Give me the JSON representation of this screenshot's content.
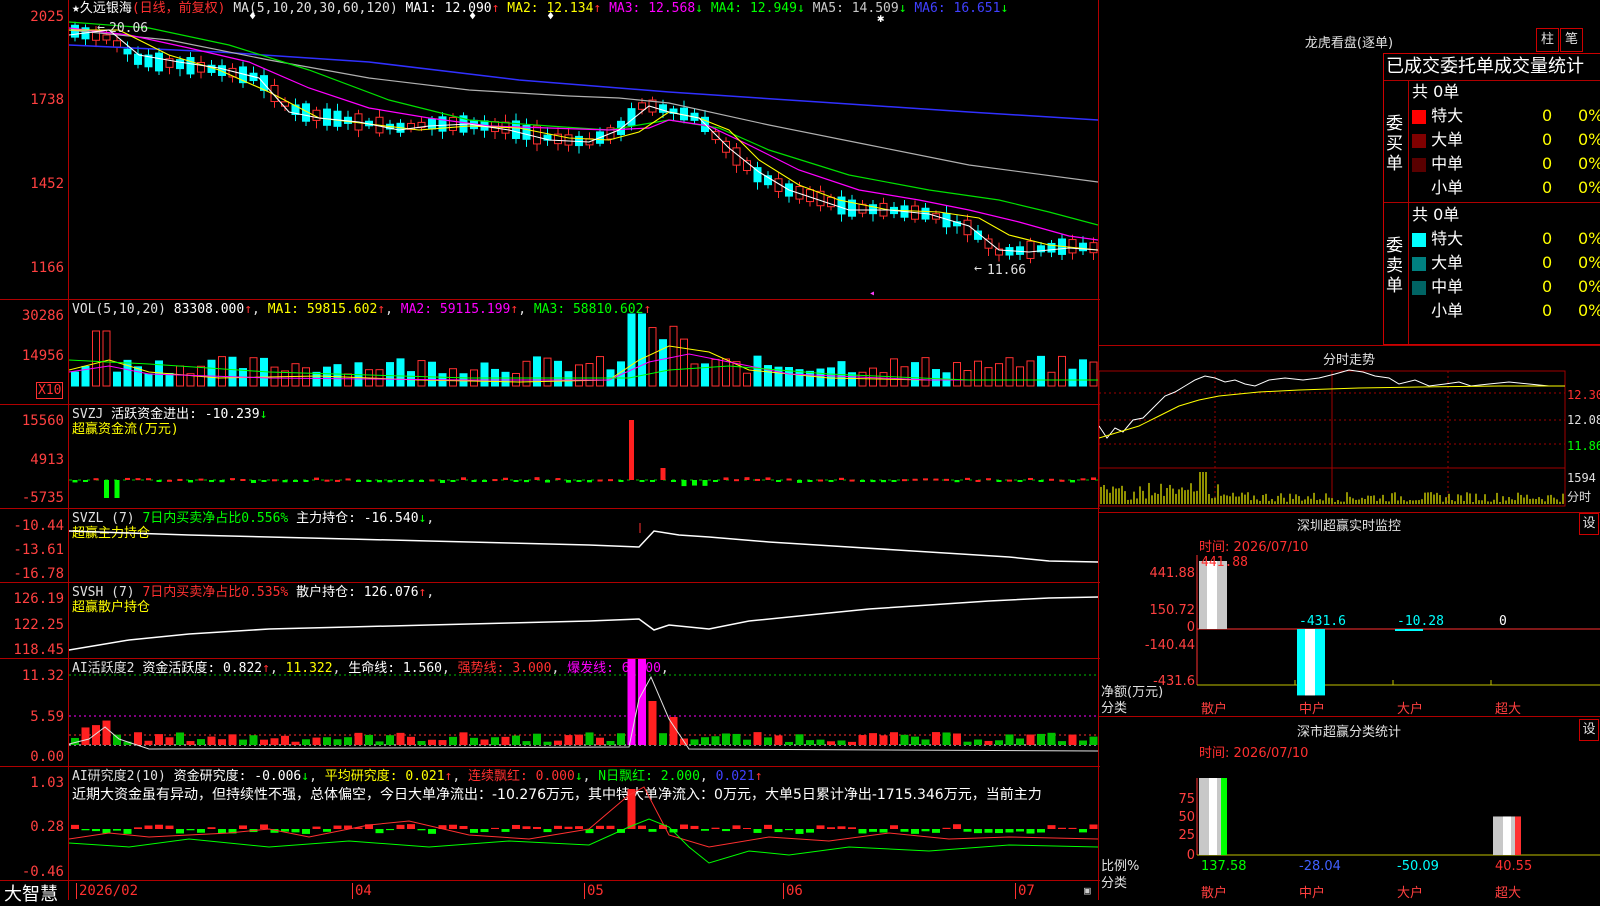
{
  "stock": {
    "star": "★",
    "name": "久远银海",
    "period": "(日线，前复权)",
    "ma_label": "MA(5,10,20,30,60,120)",
    "ma": [
      {
        "label": "MA1:",
        "value": "12.090",
        "arrow": "↑",
        "color": "#ffffff"
      },
      {
        "label": "MA2:",
        "value": "12.134",
        "arrow": "↑",
        "color": "#ffff00"
      },
      {
        "label": "MA3:",
        "value": "12.568",
        "arrow": "↓",
        "color": "#ff00ff"
      },
      {
        "label": "MA4:",
        "value": "12.949",
        "arrow": "↓",
        "color": "#00ff00"
      },
      {
        "label": "MA5:",
        "value": "14.509",
        "arrow": "↓",
        "color": "#c8c8c8"
      },
      {
        "label": "MA6:",
        "value": "16.651",
        "arrow": "↓",
        "color": "#4040ff"
      }
    ],
    "high_marker": "20.06",
    "low_marker": "11.66",
    "y_ticks": [
      "2025",
      "1738",
      "1452",
      "1166"
    ]
  },
  "vol": {
    "label": "VOL(5,10,20)",
    "value": "83308.000",
    "arrow": "↑",
    "ma": [
      {
        "label": "MA1:",
        "value": "59815.602",
        "arrow": "↑",
        "color": "#ffff00"
      },
      {
        "label": "MA2:",
        "value": "59115.199",
        "arrow": "↑",
        "color": "#ff00ff"
      },
      {
        "label": "MA3:",
        "value": "58810.602",
        "arrow": "↑",
        "color": "#00ff00"
      }
    ],
    "y_ticks": [
      "30286",
      "14956"
    ],
    "unit": "X10"
  },
  "svzj": {
    "label": "SVZJ",
    "text": "活跃资金进出: -10.239",
    "arrow": "↓",
    "subtitle": "超赢资金流(万元)",
    "y_ticks": [
      "15560",
      "4913",
      "-5735"
    ]
  },
  "svzl": {
    "label": "SVZL (7)",
    "ratio": "7日内买卖净占比0.556%",
    "text": "主力持仓: -16.540",
    "arrow": "↓",
    "subtitle": "超赢主力持仓",
    "y_ticks": [
      "-10.44",
      "-13.61",
      "-16.78"
    ]
  },
  "svsh": {
    "label": "SVSH (7)",
    "ratio": "7日内买卖净占比0.535%",
    "text": "散户持仓: 126.076",
    "arrow": "↑",
    "subtitle": "超赢散户持仓",
    "y_ticks": [
      "126.19",
      "122.25",
      "118.45"
    ]
  },
  "ai_active": {
    "label": "AI活跃度2",
    "t1": "资金活跃度: 0.822",
    "a1": "↑",
    "t2": "11.322",
    "t3": "生命线: 1.560",
    "t4": "强势线: 3.000",
    "t5": "爆发线: 6.000",
    "y_ticks": [
      "11.32",
      "5.59",
      "0.00"
    ]
  },
  "ai_research": {
    "label": "AI研究度2(10)",
    "t1": "资金研究度: -0.006",
    "a1": "↓",
    "t2": "平均研究度: 0.021",
    "a2": "↑",
    "t3": "连续飘红: 0.000",
    "a3": "↓",
    "t4": "N日飘红: 2.000",
    "t5": "0.021",
    "a5": "↑",
    "comment": "近期大资金虽有异动，但持续性不强，总体偏空，今日大单净流出：-10.276万元，其中特大单净流入：0万元，大单5日累计净出-1715.346万元，当前主力",
    "y_ticks": [
      "1.03",
      "0.28",
      "-0.46"
    ]
  },
  "dates": [
    "2026/02",
    "04",
    "05",
    "06",
    "07"
  ],
  "brand": "大智慧",
  "right": {
    "title": "龙虎看盘(逐单)",
    "tabs": [
      "柱",
      "笔"
    ],
    "header": "已成交委托单成交量统计",
    "buy": {
      "side": "委买单",
      "total": "共 0单",
      "rows": [
        {
          "label": "特大",
          "count": "0",
          "pct": "0%",
          "color": "#ff0000"
        },
        {
          "label": "大单",
          "count": "0",
          "pct": "0%",
          "color": "#800000"
        },
        {
          "label": "中单",
          "count": "0",
          "pct": "0%",
          "color": "#5a0000"
        },
        {
          "label": "小单",
          "count": "0",
          "pct": "0%",
          "color": ""
        }
      ]
    },
    "sell": {
      "side": "委卖单",
      "total": "共 0单",
      "rows": [
        {
          "label": "特大",
          "count": "0",
          "pct": "0%",
          "color": "#00ffff"
        },
        {
          "label": "大单",
          "count": "0",
          "pct": "0%",
          "color": "#008080"
        },
        {
          "label": "中单",
          "count": "0",
          "pct": "0%",
          "color": "#006464"
        },
        {
          "label": "小单",
          "count": "0",
          "pct": "0%",
          "color": ""
        }
      ]
    },
    "intraday": {
      "title": "分时走势",
      "y_labels": [
        "12.30",
        "12.08",
        "11.86"
      ],
      "vol_label": "1594",
      "vol_unit": "分时"
    },
    "sz_monitor": {
      "title": "深圳超赢实时监控",
      "set": "设",
      "time": "时间: 2026/07/10",
      "y_ticks": [
        "441.88",
        "150.72",
        "0",
        "-140.44",
        "-431.6"
      ],
      "unit": "净额(万元)",
      "cat_label": "分类",
      "categories": [
        "散户",
        "中户",
        "大户",
        "超大"
      ],
      "values": [
        "441.88",
        "-431.6",
        "-10.28",
        "0"
      ]
    },
    "sz_class": {
      "title": "深市超赢分类统计",
      "set": "设",
      "time": "时间: 2026/07/10",
      "y_ticks": [
        "75",
        "50",
        "25",
        "0"
      ],
      "unit": "比例%",
      "cat_label": "分类",
      "categories": [
        "散户",
        "中户",
        "大户",
        "超大"
      ],
      "values": [
        "137.58",
        "-28.04",
        "-50.09",
        "40.55"
      ]
    }
  }
}
